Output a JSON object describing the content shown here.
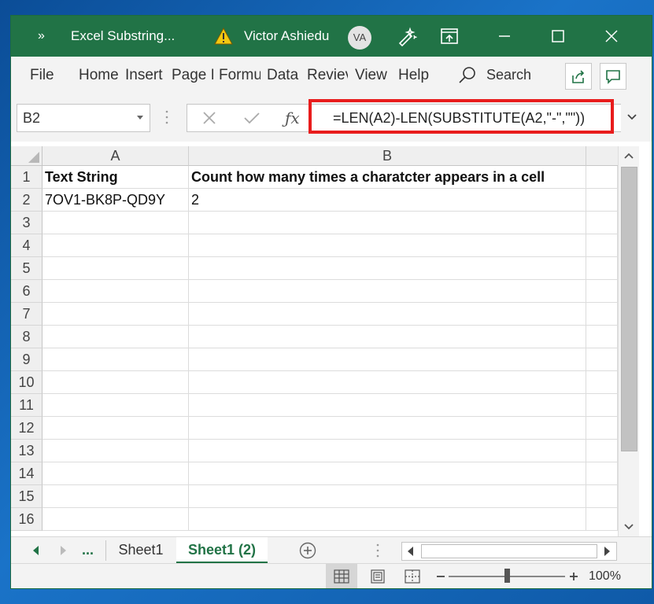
{
  "titlebar": {
    "chevrons": "»",
    "doc_title": "Excel Substring...",
    "user_name": "Victor Ashiedu",
    "avatar_initials": "VA"
  },
  "ribbon": {
    "tabs": [
      "File",
      "Home",
      "Insert",
      "Page I",
      "Formu",
      "Data",
      "Reviev",
      "View",
      "Help"
    ],
    "search_label": "Search"
  },
  "formula_bar": {
    "name_box": "B2",
    "formula": "=LEN(A2)-LEN(SUBSTITUTE(A2,\"-\",\"\"))"
  },
  "sheet": {
    "columns": [
      "A",
      "B"
    ],
    "rows": [
      "1",
      "2",
      "3",
      "4",
      "5",
      "6",
      "7",
      "8",
      "9",
      "10",
      "11",
      "12",
      "13",
      "14",
      "15",
      "16"
    ],
    "cells": {
      "A1": "Text String",
      "B1": "Count how many times a charatcter appears in a cell",
      "A2": "7OV1-BK8P-QD9Y",
      "B2": "2"
    }
  },
  "sheet_tabs": {
    "more": "...",
    "tabs": [
      "Sheet1",
      "Sheet1 (2)"
    ],
    "active_index": 1
  },
  "statusbar": {
    "zoom_label": "100%",
    "zoom_value": 100
  },
  "colors": {
    "excel_green": "#217346",
    "highlight_red": "#e81c1c"
  }
}
